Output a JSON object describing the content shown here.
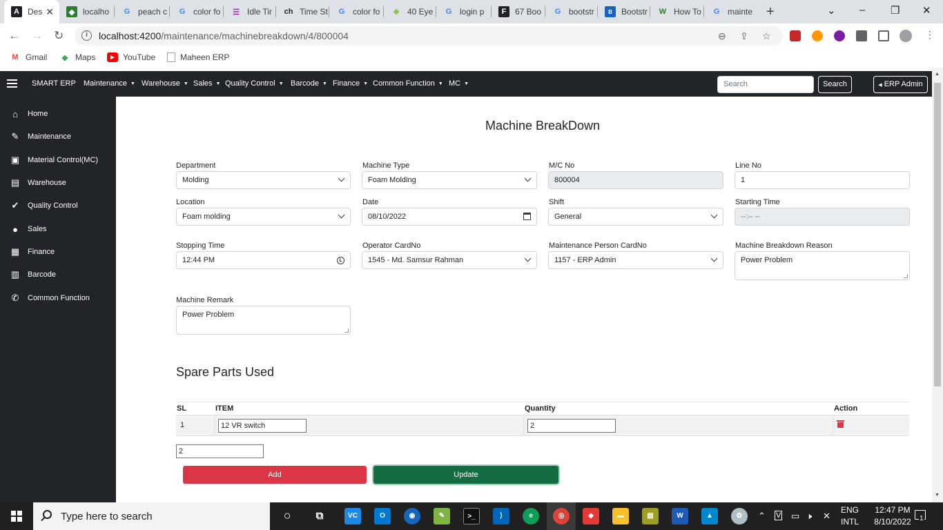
{
  "browser": {
    "tabs": [
      {
        "title": "Des",
        "icon": "angular-icon",
        "active": true
      },
      {
        "title": "localho",
        "icon": "cube-icon"
      },
      {
        "title": "peach c",
        "icon": "google-icon"
      },
      {
        "title": "color fo",
        "icon": "google-icon"
      },
      {
        "title": "Idle Tir",
        "icon": "bars-icon"
      },
      {
        "title": "Time St",
        "icon": "ch-icon"
      },
      {
        "title": "color fo",
        "icon": "google-icon"
      },
      {
        "title": "40 Eye",
        "icon": "leaf-icon"
      },
      {
        "title": "login p",
        "icon": "google-icon"
      },
      {
        "title": "67 Boo",
        "icon": "f-icon"
      },
      {
        "title": "bootstr",
        "icon": "google-icon"
      },
      {
        "title": "Bootstr",
        "icon": "bootstrap-icon"
      },
      {
        "title": "How To",
        "icon": "w-icon"
      },
      {
        "title": "mainte",
        "icon": "google-icon"
      }
    ],
    "url_host": "localhost:4200",
    "url_path": "/maintenance/machinebreakdown/4/800004",
    "bookmarks": [
      {
        "label": "Gmail",
        "icon": "gmail-icon"
      },
      {
        "label": "Maps",
        "icon": "maps-icon"
      },
      {
        "label": "YouTube",
        "icon": "youtube-icon"
      },
      {
        "label": "Maheen ERP",
        "icon": "page-icon"
      }
    ]
  },
  "navbar": {
    "brand": "SMART ERP",
    "menus": [
      "Maintenance",
      "Warehouse",
      "Sales",
      "Quality Control",
      "Barcode",
      "Finance",
      "Common Function",
      "MC"
    ],
    "search_placeholder": "Search",
    "search_button": "Search",
    "user_button": "ERP Admin"
  },
  "sidebar": {
    "items": [
      {
        "label": "Home",
        "icon": "home-icon"
      },
      {
        "label": "Maintenance",
        "icon": "wrench-icon"
      },
      {
        "label": "Material Control(MC)",
        "icon": "clipboard-icon"
      },
      {
        "label": "Warehouse",
        "icon": "warehouse-icon"
      },
      {
        "label": "Quality Control",
        "icon": "check-icon"
      },
      {
        "label": "Sales",
        "icon": "comment-icon"
      },
      {
        "label": "Finance",
        "icon": "receipt-icon"
      },
      {
        "label": "Barcode",
        "icon": "barcode-icon"
      },
      {
        "label": "Common Function",
        "icon": "phone-icon"
      }
    ]
  },
  "form": {
    "title": "Machine BreakDown",
    "department": {
      "label": "Department",
      "value": "Molding"
    },
    "machine_type": {
      "label": "Machine Type",
      "value": "Foam Molding"
    },
    "mc_no": {
      "label": "M/C No",
      "value": "800004"
    },
    "line_no": {
      "label": "Line No",
      "value": "1"
    },
    "location": {
      "label": "Location",
      "value": "Foam molding"
    },
    "date": {
      "label": "Date",
      "value": "08/10/2022"
    },
    "shift": {
      "label": "Shift",
      "value": "General"
    },
    "starting_time": {
      "label": "Starting Time",
      "value": "--:-- --"
    },
    "stopping_time": {
      "label": "Stopping Time",
      "value": "12:44 PM"
    },
    "operator": {
      "label": "Operator CardNo",
      "value": "1545 - Md. Samsur Rahman"
    },
    "maintenance_person": {
      "label": "Maintenance Person CardNo",
      "value": "1157 - ERP Admin"
    },
    "breakdown_reason": {
      "label": "Machine Breakdown Reason",
      "value": "Power Problem"
    },
    "remark": {
      "label": "Machine Remark",
      "value": "Power Problem"
    }
  },
  "spare_parts": {
    "title": "Spare Parts Used",
    "columns": [
      "SL",
      "ITEM",
      "Quantity",
      "Action"
    ],
    "rows": [
      {
        "sl": "1",
        "item": "12 VR switch",
        "quantity": "2"
      }
    ],
    "extra_input": "2",
    "add_label": "Add",
    "update_label": "Update"
  },
  "taskbar": {
    "search_placeholder": "Type here to search",
    "lang_line1": "ENG",
    "lang_line2": "INTL",
    "time": "12:47 PM",
    "date": "8/10/2022",
    "notifications": "1"
  }
}
